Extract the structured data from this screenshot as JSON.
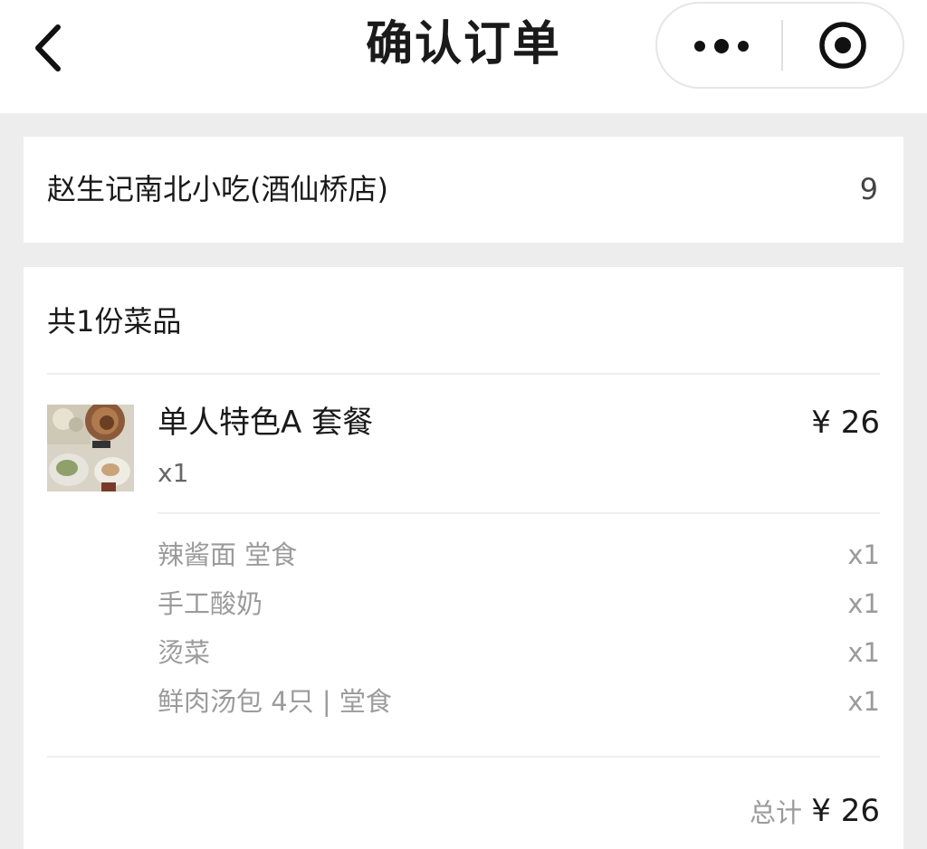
{
  "nav": {
    "title": "确认订单",
    "back_icon": "chevron-left-icon",
    "more_icon": "more-dots-icon",
    "close_icon": "target-close-icon"
  },
  "shop": {
    "name": "赵生记南北小吃(酒仙桥店)",
    "count": "9"
  },
  "order": {
    "dish_count_label": "共1份菜品",
    "item": {
      "name": "单人特色A 套餐",
      "qty": "x1",
      "price": "¥ 26"
    },
    "sub_items": [
      {
        "name": "辣酱面 堂食",
        "qty": "x1"
      },
      {
        "name": "手工酸奶",
        "qty": "x1"
      },
      {
        "name": "烫菜",
        "qty": "x1"
      },
      {
        "name": "鲜肉汤包 4只 | 堂食",
        "qty": "x1"
      }
    ],
    "total_label": "总计",
    "total_value": "¥ 26"
  }
}
